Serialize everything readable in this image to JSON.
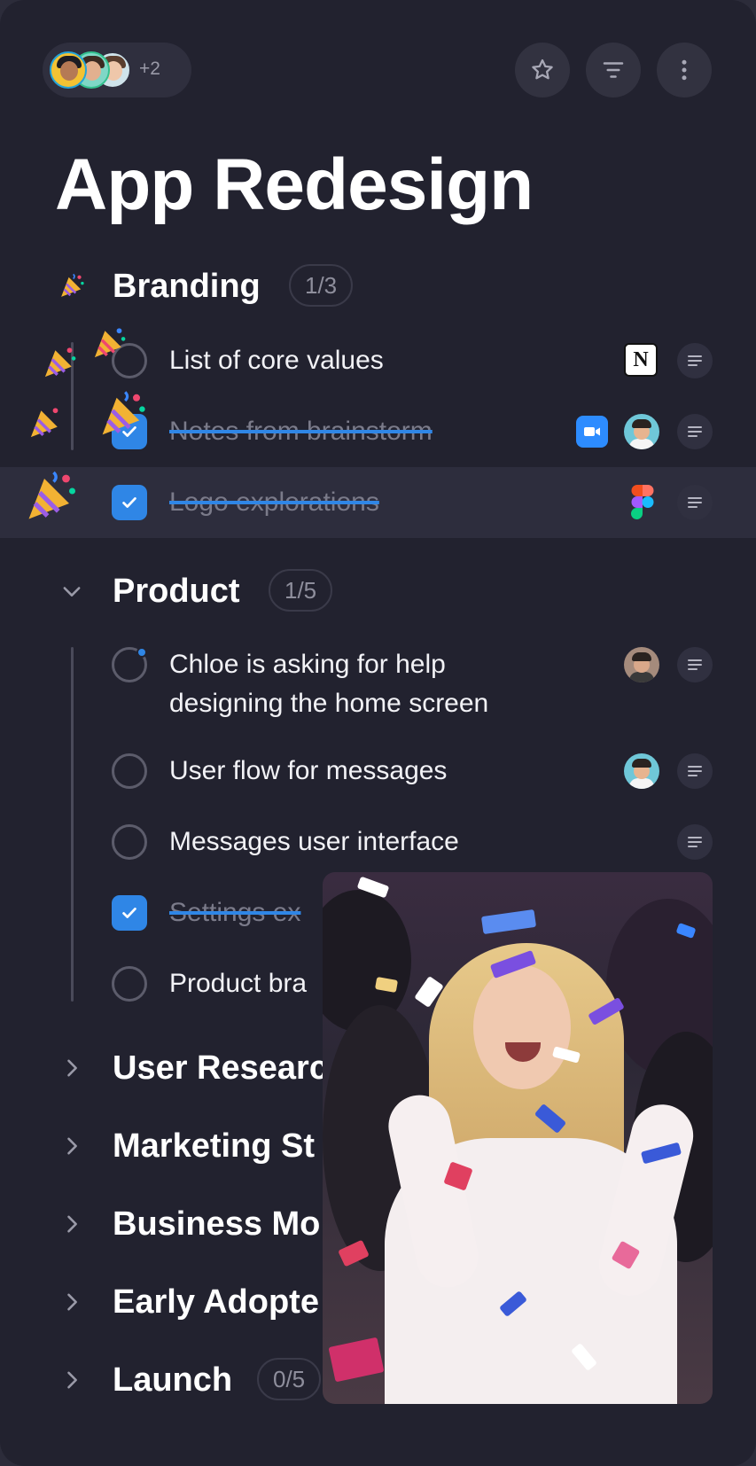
{
  "header": {
    "more_collaborators": "+2",
    "buttons": [
      "star-icon",
      "filter-icon",
      "more-vertical-icon"
    ]
  },
  "page": {
    "title": "App Redesign"
  },
  "sections": [
    {
      "title": "Branding",
      "progress": "1/3",
      "expanded": true,
      "tasks": [
        {
          "label": "List of core values",
          "done": false,
          "attachment": "notion-icon"
        },
        {
          "label": "Notes from brainstorm",
          "done": true,
          "attachment": "zoom-icon",
          "assignee": "avatar"
        },
        {
          "label": "Logo explorations",
          "done": true,
          "attachment": "figma-icon",
          "highlighted": true
        }
      ]
    },
    {
      "title": "Product",
      "progress": "1/5",
      "expanded": true,
      "tasks": [
        {
          "label_line1": "Chloe is asking for help",
          "label_line2": "designing the home screen",
          "done": false,
          "unread": true,
          "assignee": "avatar"
        },
        {
          "label": "User flow for messages",
          "done": false,
          "assignee": "avatar"
        },
        {
          "label": "Messages user interface",
          "done": false
        },
        {
          "label": "Settings ex",
          "done": true
        },
        {
          "label": "Product bra",
          "done": false
        }
      ]
    },
    {
      "title": "User Researc",
      "expanded": false
    },
    {
      "title": "Marketing St",
      "expanded": false
    },
    {
      "title": "Business Mo",
      "expanded": false
    },
    {
      "title": "Early Adopte",
      "expanded": false
    },
    {
      "title": "Launch",
      "progress": "0/5",
      "expanded": false
    }
  ],
  "colors": {
    "background": "#22222f",
    "accent": "#2f86e6",
    "zoom": "#2d8cff"
  },
  "overlay": {
    "type": "celebration-gif"
  }
}
